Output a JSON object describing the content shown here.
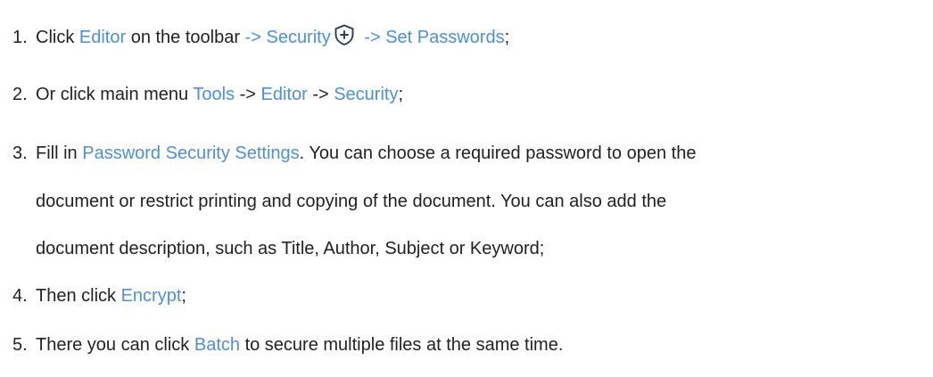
{
  "steps": [
    {
      "number": "1.",
      "click": "Click ",
      "editor": "Editor",
      "on_toolbar": " on the toolbar ",
      "arrow_security": "-> Security",
      "arrow_set_passwords": " -> Set Passwords",
      "end": ";",
      "icon": "shield-plus-icon"
    },
    {
      "number": "2.",
      "prefix": "Or click main menu ",
      "tools": "Tools",
      "arrow1": " -> ",
      "editor": "Editor",
      "arrow2": " -> ",
      "security": "Security",
      "end": ";"
    },
    {
      "number": "3.",
      "prefix": "Fill in ",
      "password_settings": "Password Security Settings",
      "line1_rest": ". You can choose a required password to open the",
      "line2": "document or restrict printing and copying of the document. You can also add the",
      "line3": "document description, such as Title, Author, Subject or Keyword;"
    },
    {
      "number": "4.",
      "prefix": "Then click ",
      "encrypt": "Encrypt",
      "end": ";"
    },
    {
      "number": "5.",
      "prefix": "There you can click ",
      "batch": "Batch",
      "rest": " to secure multiple files at the same time."
    }
  ],
  "colors": {
    "text": "#222222",
    "link": "#4a90e2"
  }
}
